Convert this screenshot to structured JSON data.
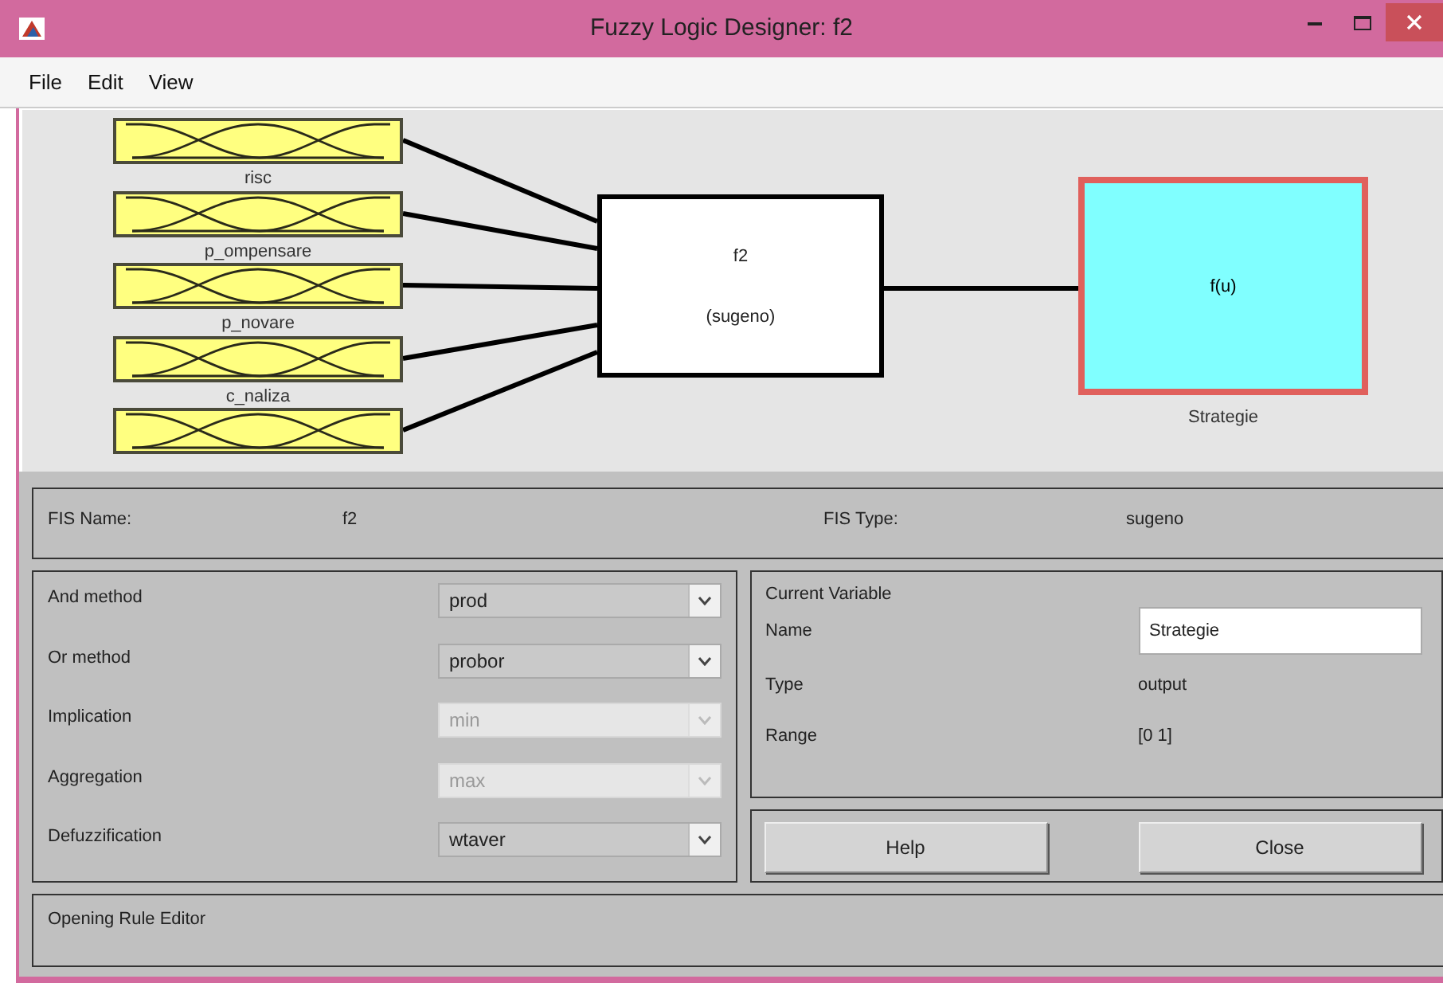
{
  "window": {
    "title": "Fuzzy Logic Designer: f2"
  },
  "menu": [
    "File",
    "Edit",
    "View"
  ],
  "diagram": {
    "inputs": [
      {
        "name": "risc",
        "selected": false
      },
      {
        "name": "p_ompensare",
        "selected": false
      },
      {
        "name": "p_novare",
        "selected": false
      },
      {
        "name": "c_naliza",
        "selected": false
      },
      {
        "selected": false
      }
    ],
    "system": {
      "name": "f2",
      "type": "(sugeno)"
    },
    "output": {
      "function": "f(u)",
      "name": "Strategie",
      "selected": true
    }
  },
  "fis": {
    "name_label": "FIS Name:",
    "name": "f2",
    "type_label": "FIS Type:",
    "type": "sugeno"
  },
  "methods": [
    {
      "label": "And method",
      "value": "prod",
      "disabled": false
    },
    {
      "label": "Or method",
      "value": "probor",
      "disabled": false
    },
    {
      "label": "Implication",
      "value": "min",
      "disabled": true
    },
    {
      "label": "Aggregation",
      "value": "max",
      "disabled": true
    },
    {
      "label": "Defuzzification",
      "value": "wtaver",
      "disabled": false
    }
  ],
  "current_variable": {
    "title": "Current Variable",
    "name_label": "Name",
    "name": "Strategie",
    "type_label": "Type",
    "type": "output",
    "range_label": "Range",
    "range": "[0 1]"
  },
  "buttons": [
    "Help",
    "Close"
  ],
  "status": "Opening Rule Editor"
}
